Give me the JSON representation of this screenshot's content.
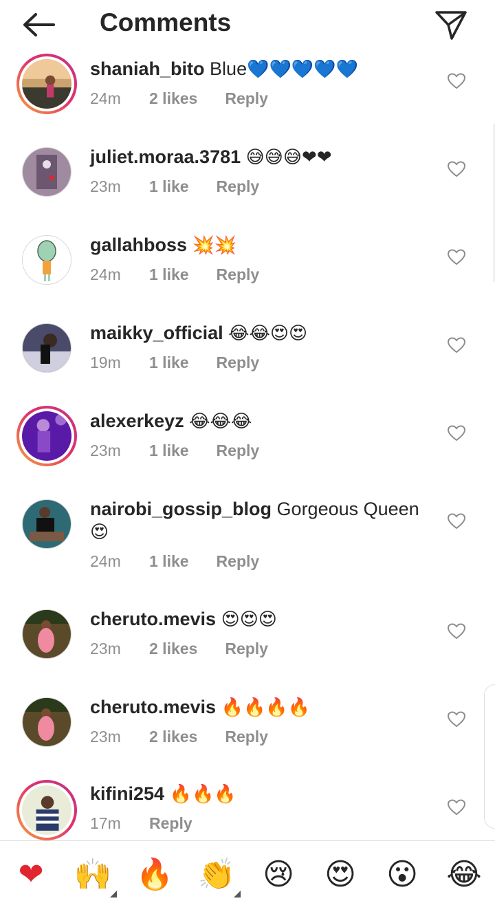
{
  "header": {
    "title": "Comments",
    "back_icon": "arrow-left-icon",
    "send_icon": "paper-plane-icon"
  },
  "comments": [
    {
      "username": "shaniah_bito",
      "text": "Blue",
      "emoji": "💙💙💙💙💙",
      "time": "24m",
      "likes": "2 likes",
      "reply": "Reply",
      "story": true
    },
    {
      "username": "juliet.moraa.3781",
      "text": "",
      "emoji": "😅😅😅❤❤",
      "time": "23m",
      "likes": "1 like",
      "reply": "Reply",
      "story": false
    },
    {
      "username": "gallahboss",
      "text": "",
      "emoji": "💥💥",
      "time": "24m",
      "likes": "1 like",
      "reply": "Reply",
      "story": false
    },
    {
      "username": "maikky_official",
      "text": "",
      "emoji": "😂😂😍😍",
      "time": "19m",
      "likes": "1 like",
      "reply": "Reply",
      "story": false
    },
    {
      "username": "alexerkeyz",
      "text": "",
      "emoji": "😂😂😂",
      "time": "23m",
      "likes": "1 like",
      "reply": "Reply",
      "story": true
    },
    {
      "username": "nairobi_gossip_blog",
      "text": "Gorgeous Queen",
      "emoji": "😍",
      "time": "24m",
      "likes": "1 like",
      "reply": "Reply",
      "story": false
    },
    {
      "username": "cheruto.mevis",
      "text": "",
      "emoji": "😍😍😍",
      "time": "23m",
      "likes": "2 likes",
      "reply": "Reply",
      "story": false
    },
    {
      "username": "cheruto.mevis",
      "text": "",
      "emoji": "🔥🔥🔥🔥",
      "time": "23m",
      "likes": "2 likes",
      "reply": "Reply",
      "story": false
    },
    {
      "username": "kifini254",
      "text": "",
      "emoji": "🔥🔥🔥",
      "time": "17m",
      "likes": "",
      "reply": "Reply",
      "story": true
    }
  ],
  "quick_reactions": [
    "❤",
    "🙌",
    "🔥",
    "👏",
    "😢",
    "😍",
    "😮",
    "😂"
  ],
  "colors": {
    "accent_heart": "#e0262e",
    "story_ring": "#e1306c",
    "secondary_text": "#8e8e8e"
  }
}
